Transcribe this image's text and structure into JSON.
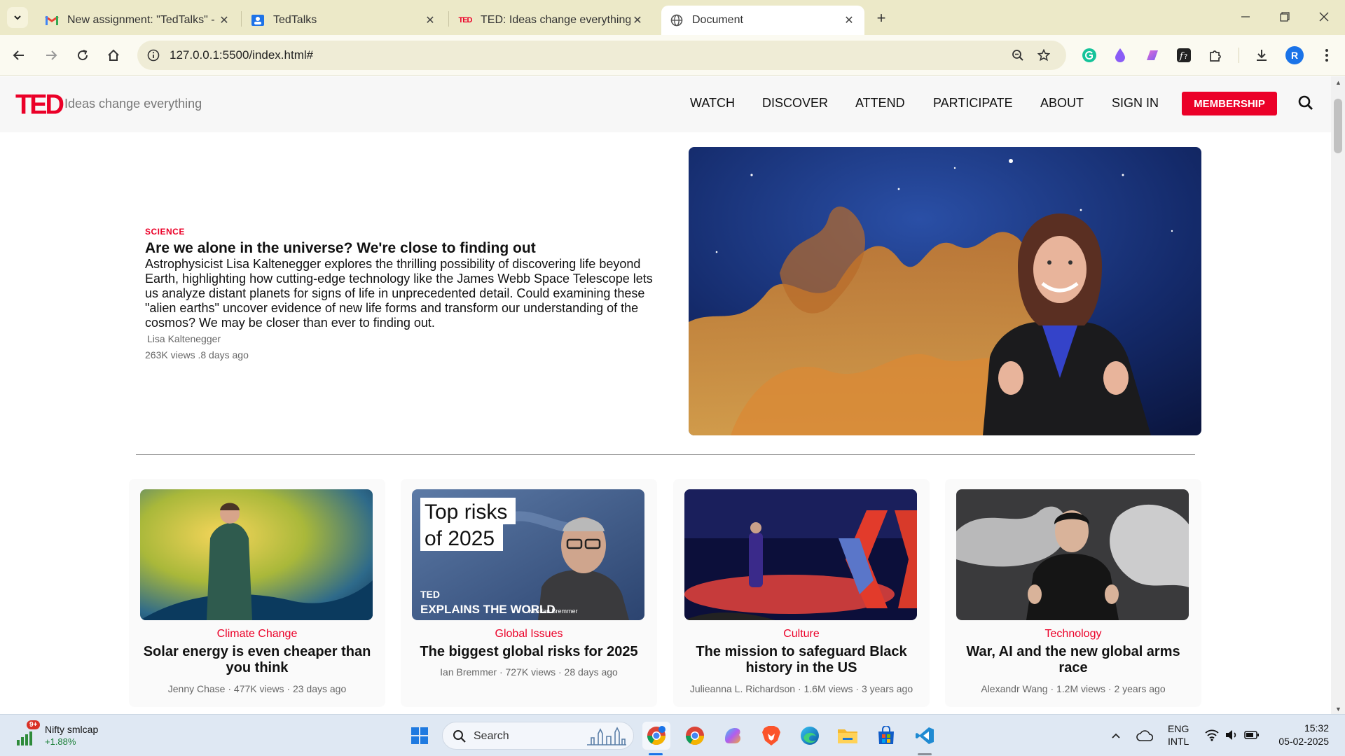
{
  "browser": {
    "tabs": [
      {
        "title": "New assignment: \"TedTalks\" - st",
        "icon": "gmail-icon",
        "active": false
      },
      {
        "title": "TedTalks",
        "icon": "google-classroom-icon",
        "active": false
      },
      {
        "title": "TED: Ideas change everything",
        "icon": "ted-icon",
        "active": false
      },
      {
        "title": "Document",
        "icon": "globe-icon",
        "active": true
      }
    ],
    "ted_favicon_text": "TED",
    "url": "127.0.0.1:5500/index.html#",
    "profile_initial": "R"
  },
  "site": {
    "logo": "TED",
    "tagline": "Ideas change everything",
    "nav": [
      "WATCH",
      "DISCOVER",
      "ATTEND",
      "PARTICIPATE",
      "ABOUT",
      "SIGN IN"
    ],
    "membership_label": "MEMBERSHIP",
    "accent_color": "#eb0028"
  },
  "hero": {
    "category": "SCIENCE",
    "title": "Are we alone in the universe? We're close to finding out",
    "description_lines": [
      "Astrophysicist Lisa Kaltenegger explores the thrilling possibility of discovering life beyond",
      "Earth, highlighting how cutting-edge technology like the James Webb Space Telescope lets",
      "us analyze distant planets for signs of life in unprecedented detail. Could examining these",
      "\"alien earths\" uncover evidence of new life forms and transform our understanding of the",
      "cosmos? We may be closer than ever to finding out."
    ],
    "author": "Lisa Kaltenegger",
    "meta": "263K views .8 days ago"
  },
  "cards": [
    {
      "category": "Climate Change",
      "title": "Solar energy is even cheaper than you think",
      "meta": "Jenny Chase · 477K views · 23 days ago"
    },
    {
      "category": "Global Issues",
      "title": "The biggest global risks for 2025",
      "meta": "Ian Bremmer · 727K views · 28 days ago",
      "thumb_text": {
        "line1": "Top risks",
        "line2": "of 2025",
        "brand": "TED",
        "series": "EXPLAINS THE WORLD",
        "with": "with Ian Bremmer"
      }
    },
    {
      "category": "Culture",
      "title": "The mission to safeguard Black history in the US",
      "meta": "Julieanna L. Richardson · 1.6M views · 3 years ago"
    },
    {
      "category": "Technology",
      "title": "War, AI and the new global arms race",
      "meta": "Alexandr Wang · 1.2M views · 2 years ago"
    }
  ],
  "taskbar": {
    "widget_title": "Nifty smlcap",
    "widget_value": "+1.88%",
    "widget_badge": "9+",
    "search_label": "Search",
    "lang_line1": "ENG",
    "lang_line2": "INTL",
    "time": "15:32",
    "date": "05-02-2025"
  }
}
